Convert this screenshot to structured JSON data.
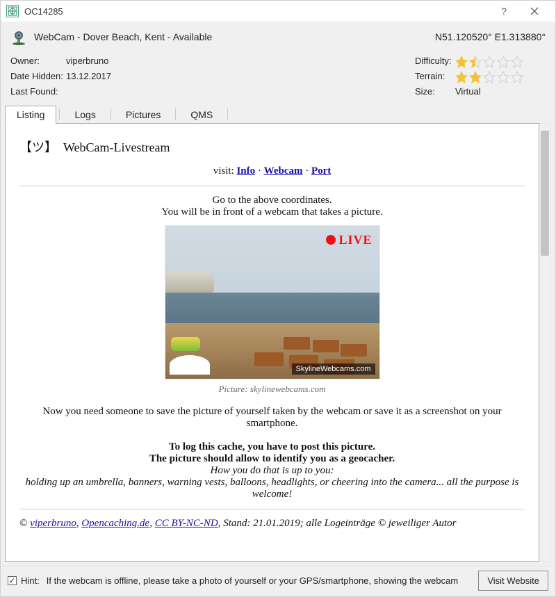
{
  "titlebar": {
    "title": "OC14285"
  },
  "header": {
    "name": "WebCam - Dover Beach, Kent - Available",
    "coords": "N51.120520° E1.313880°"
  },
  "info": {
    "owner_label": "Owner:",
    "owner": "viperbruno",
    "date_hidden_label": "Date Hidden:",
    "date_hidden": "13.12.2017",
    "last_found_label": "Last Found:",
    "last_found": "",
    "difficulty_label": "Difficulty:",
    "difficulty_value": 1.5,
    "terrain_label": "Terrain:",
    "terrain_value": 2,
    "size_label": "Size:",
    "size": "Virtual"
  },
  "tabs": {
    "items": [
      "Listing",
      "Logs",
      "Pictures",
      "QMS"
    ],
    "active_index": 0
  },
  "content": {
    "emoji": "【ツ】",
    "title": "WebCam-Livestream",
    "visit_label": "visit: ",
    "links": {
      "info": "Info",
      "webcam": "Webcam",
      "port": "Port"
    },
    "line1": "Go to the above coordinates.",
    "line2": "You will be in front of a webcam that takes a picture.",
    "live_label": "LIVE",
    "watermark": "SkylineWebcams.com",
    "caption": "Picture: skylinewebcams.com",
    "para1": "Now you need someone to save the picture of yourself taken by the webcam or save it as a screenshot on your smartphone.",
    "bold1": "To log this cache, you have to post this picture.",
    "bold2": "The picture should allow to identify you as a geocacher.",
    "italic1": "How you do that is up to you:",
    "italic2": "holding up an umbrella, banners, warning vests, balloons, headlights, or cheering into the camera... all the purpose is welcome!",
    "credit_prefix": "© ",
    "credit_links": {
      "a": "viperbruno",
      "b": "Opencaching.de",
      "c": "CC BY-NC-ND"
    },
    "credit_suffix": ", Stand: 21.01.2019; alle Logeinträge © jeweiliger Autor"
  },
  "bottom": {
    "checked": true,
    "hint_label": "Hint:",
    "hint_text": "If the webcam is offline, please take a photo of yourself or your GPS/smartphone, showing the webcam",
    "visit_button": "Visit Website"
  }
}
